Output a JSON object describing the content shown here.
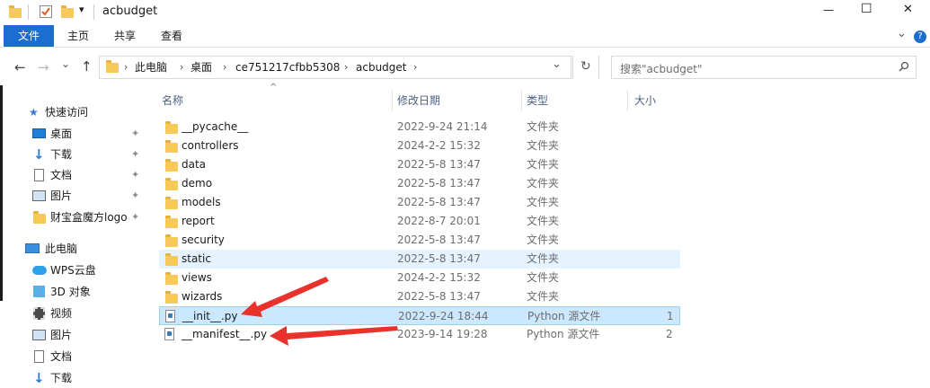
{
  "window": {
    "title": "acbudget",
    "minimize_glyph": "—",
    "maximize_glyph": "☐",
    "close_glyph": "✕"
  },
  "ribbon": {
    "tabs": [
      "文件",
      "主页",
      "共享",
      "查看"
    ],
    "expand_glyph": "⌄",
    "help_glyph": "?"
  },
  "nav": {
    "back_glyph": "←",
    "forward_glyph": "→",
    "recent_glyph": "⌄",
    "up_glyph": "↑",
    "refresh_glyph": "↻",
    "dropdown_glyph": "⌄"
  },
  "address": {
    "crumbs": [
      "此电脑",
      "桌面",
      "ce751217cfbb5308",
      "acbudget"
    ],
    "separator": "›"
  },
  "search": {
    "placeholder": "搜索\"acbudget\"",
    "icon": "search-icon"
  },
  "columns": {
    "name": "名称",
    "modified": "修改日期",
    "type": "类型",
    "size": "大小",
    "sort_glyph": "^"
  },
  "files": [
    {
      "name": "__pycache__",
      "modified": "2022-9-24 21:14",
      "type": "文件夹",
      "size": "",
      "kind": "folder"
    },
    {
      "name": "controllers",
      "modified": "2024-2-2 15:32",
      "type": "文件夹",
      "size": "",
      "kind": "folder"
    },
    {
      "name": "data",
      "modified": "2022-5-8 13:47",
      "type": "文件夹",
      "size": "",
      "kind": "folder"
    },
    {
      "name": "demo",
      "modified": "2022-5-8 13:47",
      "type": "文件夹",
      "size": "",
      "kind": "folder"
    },
    {
      "name": "models",
      "modified": "2022-5-8 13:47",
      "type": "文件夹",
      "size": "",
      "kind": "folder"
    },
    {
      "name": "report",
      "modified": "2022-8-7 20:01",
      "type": "文件夹",
      "size": "",
      "kind": "folder"
    },
    {
      "name": "security",
      "modified": "2022-5-8 13:47",
      "type": "文件夹",
      "size": "",
      "kind": "folder"
    },
    {
      "name": "static",
      "modified": "2022-5-8 13:47",
      "type": "文件夹",
      "size": "",
      "kind": "folder"
    },
    {
      "name": "views",
      "modified": "2024-2-2 15:32",
      "type": "文件夹",
      "size": "",
      "kind": "folder"
    },
    {
      "name": "wizards",
      "modified": "2022-5-8 13:47",
      "type": "文件夹",
      "size": "",
      "kind": "folder"
    },
    {
      "name": "__init__.py",
      "modified": "2022-9-24 18:44",
      "type": "Python 源文件",
      "size": "1",
      "kind": "python"
    },
    {
      "name": "__manifest__.py",
      "modified": "2023-9-14 19:28",
      "type": "Python 源文件",
      "size": "2",
      "kind": "python"
    }
  ],
  "sidebar": {
    "quick_access": "快速访问",
    "pinned": [
      {
        "label": "桌面",
        "icon": "desktop-icon"
      },
      {
        "label": "下载",
        "icon": "download-icon"
      },
      {
        "label": "文档",
        "icon": "document-icon"
      },
      {
        "label": "图片",
        "icon": "picture-icon"
      },
      {
        "label": "财宝盒魔方logo",
        "icon": "folder-icon"
      }
    ],
    "pin_glyph": "📌",
    "this_pc": "此电脑",
    "pc_items": [
      {
        "label": "WPS云盘",
        "icon": "cloud-icon"
      },
      {
        "label": "3D 对象",
        "icon": "3d-objects-icon"
      },
      {
        "label": "视频",
        "icon": "video-icon"
      },
      {
        "label": "图片",
        "icon": "picture-icon"
      },
      {
        "label": "文档",
        "icon": "document-icon"
      },
      {
        "label": "下载",
        "icon": "download-icon"
      }
    ]
  },
  "colors": {
    "accent": "#1c6dd0",
    "hover_row": "#e5f3ff",
    "selected_row": "#cce8ff",
    "arrow": "#e8322b"
  }
}
